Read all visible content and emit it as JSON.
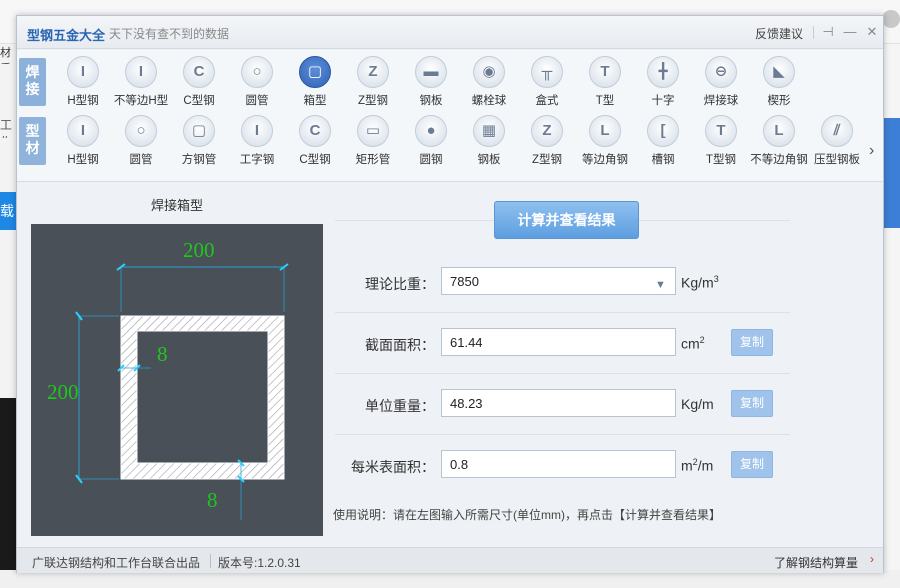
{
  "background": {
    "left_tab1": "材质",
    "left_tab2": "工作",
    "left_blue_text": "载"
  },
  "app": {
    "title": "型钢五金大全",
    "slogan": "天下没有查不到的数据",
    "feedback": "反馈建议"
  },
  "window_controls": {
    "pin": "⊣",
    "minimize": "—",
    "close": "✕"
  },
  "toolbar": {
    "row1_label": "焊\n接",
    "row1": [
      {
        "label": "H型钢",
        "icon": "I"
      },
      {
        "label": "不等边H型",
        "icon": "I"
      },
      {
        "label": "C型钢",
        "icon": "C"
      },
      {
        "label": "圆管",
        "icon": "○"
      },
      {
        "label": "箱型",
        "icon": "▢"
      },
      {
        "label": "Z型钢",
        "icon": "Z"
      },
      {
        "label": "钢板",
        "icon": "▬"
      },
      {
        "label": "螺栓球",
        "icon": "◉"
      },
      {
        "label": "盒式",
        "icon": "╥"
      },
      {
        "label": "T型",
        "icon": "T"
      },
      {
        "label": "十字",
        "icon": "╋"
      },
      {
        "label": "焊接球",
        "icon": "⊖"
      },
      {
        "label": "楔形",
        "icon": "◣"
      }
    ],
    "row2_label": "型\n材",
    "row2": [
      {
        "label": "H型钢",
        "icon": "I"
      },
      {
        "label": "圆管",
        "icon": "○"
      },
      {
        "label": "方钢管",
        "icon": "▢"
      },
      {
        "label": "工字钢",
        "icon": "I"
      },
      {
        "label": "C型钢",
        "icon": "C"
      },
      {
        "label": "矩形管",
        "icon": "▭"
      },
      {
        "label": "圆钢",
        "icon": "●"
      },
      {
        "label": "钢板",
        "icon": "▦"
      },
      {
        "label": "Z型钢",
        "icon": "Z"
      },
      {
        "label": "等边角钢",
        "icon": "L"
      },
      {
        "label": "槽钢",
        "icon": "["
      },
      {
        "label": "T型钢",
        "icon": "T"
      },
      {
        "label": "不等边角钢",
        "icon": "L"
      },
      {
        "label": "压型钢板",
        "icon": "⫽"
      }
    ],
    "active": "箱型",
    "scroll_arrow": "›"
  },
  "diagram": {
    "title": "焊接箱型",
    "width": "200",
    "height": "200",
    "web_thickness": "8",
    "flange_thickness": "8"
  },
  "calc": {
    "button": "计算并查看结果",
    "density_label": "理论比重：",
    "density_value": "7850",
    "density_unit": "Kg/m",
    "density_unit_sup": "3",
    "area_label": "截面面积：",
    "area_value": "61.44",
    "area_unit": "cm",
    "area_unit_sup": "2",
    "weight_label": "单位重量：",
    "weight_value": "48.23",
    "weight_unit": "Kg/m",
    "surface_label": "每米表面积：",
    "surface_value": "0.8",
    "surface_unit": "m",
    "surface_unit_sup": "2",
    "surface_unit_suffix": "/m",
    "copy": "复制",
    "usage": "使用说明：请在左图输入所需尺寸(单位mm)，再点击【计算并查看结果】"
  },
  "status": {
    "publisher": "广联达钢结构和工作台联合出品",
    "version": "版本号:1.2.0.31",
    "link": "了解钢结构算量",
    "link_icon": "›"
  }
}
